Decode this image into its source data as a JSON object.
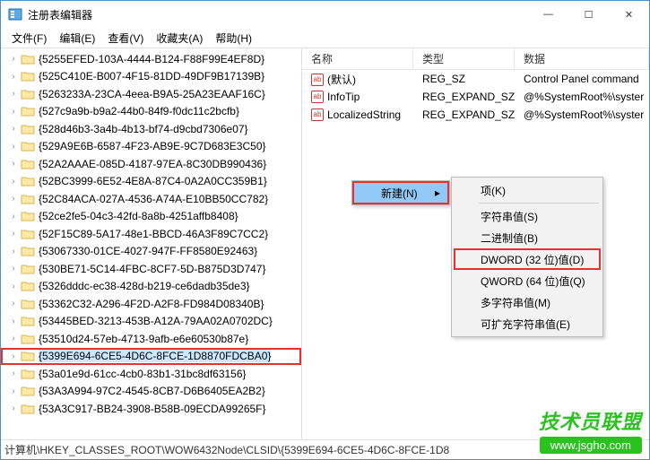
{
  "window": {
    "title": "注册表编辑器",
    "min": "—",
    "max": "☐",
    "close": "✕"
  },
  "menu": {
    "file": "文件(F)",
    "edit": "编辑(E)",
    "view": "查看(V)",
    "favorites": "收藏夹(A)",
    "help": "帮助(H)"
  },
  "tree": [
    "{5255EFED-103A-4444-B124-F88F99E4EF8D}",
    "{525C410E-B007-4F15-81DD-49DF9B17139B}",
    "{5263233A-23CA-4eea-B9A5-25A23EAAF16C}",
    "{527c9a9b-b9a2-44b0-84f9-f0dc11c2bcfb}",
    "{528d46b3-3a4b-4b13-bf74-d9cbd7306e07}",
    "{529A9E6B-6587-4F23-AB9E-9C7D683E3C50}",
    "{52A2AAAE-085D-4187-97EA-8C30DB990436}",
    "{52BC3999-6E52-4E8A-87C4-0A2A0CC359B1}",
    "{52C84ACA-027A-4536-A74A-E10BB50CC782}",
    "{52ce2fe5-04c3-42fd-8a8b-4251affb8408}",
    "{52F15C89-5A17-48e1-BBCD-46A3F89C7CC2}",
    "{53067330-01CE-4027-947F-FF8580E92463}",
    "{530BE71-5C14-4FBC-8CF7-5D-B875D3D747}",
    "{5326dddc-ec38-428d-b219-ce6dadb35de3}",
    "{53362C32-A296-4F2D-A2F8-FD984D08340B}",
    "{53445BED-3213-453B-A12A-79AA02A0702DC}",
    "{53510d24-57eb-4713-9afb-e6e60530b87e}",
    "{5399E694-6CE5-4D6C-8FCE-1D8870FDCBA0}",
    "{53a01e9d-61cc-4cb0-83b1-31bc8df63156}",
    "{53A3A994-97C2-4545-8CB7-D6B6405EA2B2}",
    "{53A3C917-BB24-3908-B58B-09ECDA99265F}"
  ],
  "selected_index": 17,
  "columns": {
    "name": "名称",
    "type": "类型",
    "data": "数据"
  },
  "values": [
    {
      "name": "(默认)",
      "type": "REG_SZ",
      "data": "Control Panel command"
    },
    {
      "name": "InfoTip",
      "type": "REG_EXPAND_SZ",
      "data": "@%SystemRoot%\\syster"
    },
    {
      "name": "LocalizedString",
      "type": "REG_EXPAND_SZ",
      "data": "@%SystemRoot%\\syster"
    }
  ],
  "context": {
    "new": "新建(N)",
    "sub": {
      "key": "项(K)",
      "string": "字符串值(S)",
      "binary": "二进制值(B)",
      "dword": "DWORD (32 位)值(D)",
      "qword": "QWORD (64 位)值(Q)",
      "multi": "多字符串值(M)",
      "expand": "可扩充字符串值(E)"
    }
  },
  "statusbar": "计算机\\HKEY_CLASSES_ROOT\\WOW6432Node\\CLSID\\{5399E694-6CE5-4D6C-8FCE-1D8",
  "watermark": {
    "top": "技术员联盟",
    "bot": "www.jsgho.com"
  }
}
